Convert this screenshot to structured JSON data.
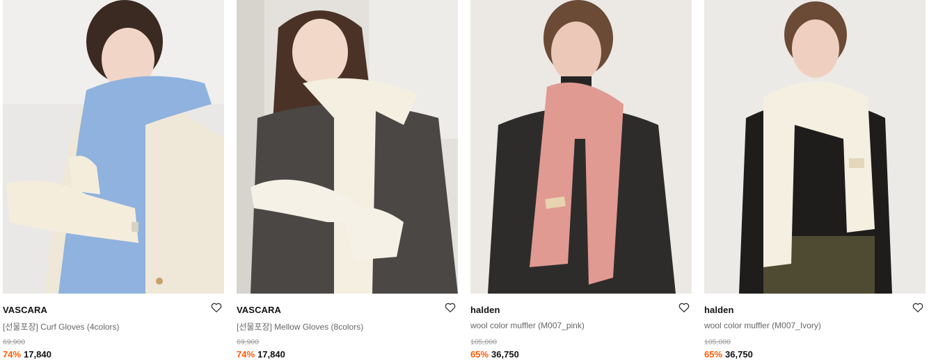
{
  "products": [
    {
      "brand": "VASCARA",
      "title": "[선물포장] Curf Gloves (4colors)",
      "original_price": "69,900",
      "discount": "74%",
      "price": "17,840",
      "image_colors": {
        "bg": "#e9e8e6",
        "garment": "#efe7d8",
        "scarf": "#8fb2de",
        "hair": "#3b2a22",
        "skin": "#f1d6c8"
      }
    },
    {
      "brand": "VASCARA",
      "title": "[선물포장] Mellow Gloves (8colors)",
      "original_price": "69,900",
      "discount": "74%",
      "price": "17,840",
      "image_colors": {
        "bg": "#e4e1dc",
        "garment": "#4a4744",
        "scarf": "#f4efe0",
        "hair": "#4a3326",
        "skin": "#f2d8c8"
      }
    },
    {
      "brand": "halden",
      "title": "wool color muffler (M007_pink)",
      "original_price": "105,000",
      "discount": "65%",
      "price": "36,750",
      "image_colors": {
        "bg": "#ece9e5",
        "garment": "#2e2c2b",
        "scarf": "#e09a92",
        "hair": "#6b4a36",
        "skin": "#ecc8b8"
      }
    },
    {
      "brand": "halden",
      "title": "wool color muffler (M007_Ivory)",
      "original_price": "105,000",
      "discount": "65%",
      "price": "36,750",
      "image_colors": {
        "bg": "#eceae7",
        "garment": "#1e1d1c",
        "scarf": "#f4efe0",
        "hair": "#6b4a36",
        "skin": "#efd0c0"
      }
    }
  ],
  "icons": {
    "wishlist": "heart-outline-icon"
  },
  "colors": {
    "discount": "#ff5a00",
    "original_price": "#9a9a9a",
    "title": "#666666"
  }
}
